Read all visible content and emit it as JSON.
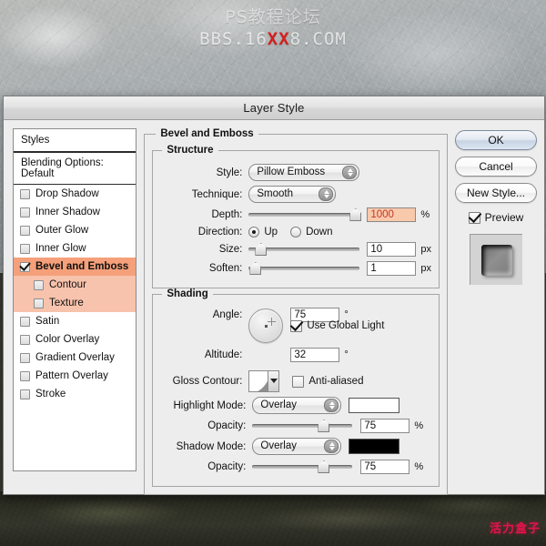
{
  "watermark": {
    "top_line1": "PS教程论坛",
    "top_line2_pre": "BBS.16",
    "top_line2_red": "XX",
    "top_line2_post": "8.COM",
    "bottom": "活力盒子"
  },
  "dialog": {
    "title": "Layer Style"
  },
  "styles_panel": {
    "header": "Styles",
    "blending_options": "Blending Options: Default",
    "effects": [
      {
        "label": "Drop Shadow",
        "checked": false,
        "sub": false,
        "selected": false
      },
      {
        "label": "Inner Shadow",
        "checked": false,
        "sub": false,
        "selected": false
      },
      {
        "label": "Outer Glow",
        "checked": false,
        "sub": false,
        "selected": false
      },
      {
        "label": "Inner Glow",
        "checked": false,
        "sub": false,
        "selected": false
      },
      {
        "label": "Bevel and Emboss",
        "checked": true,
        "sub": false,
        "selected": true
      },
      {
        "label": "Contour",
        "checked": false,
        "sub": true,
        "selected": false
      },
      {
        "label": "Texture",
        "checked": false,
        "sub": true,
        "selected": false
      },
      {
        "label": "Satin",
        "checked": false,
        "sub": false,
        "selected": false
      },
      {
        "label": "Color Overlay",
        "checked": false,
        "sub": false,
        "selected": false
      },
      {
        "label": "Gradient Overlay",
        "checked": false,
        "sub": false,
        "selected": false
      },
      {
        "label": "Pattern Overlay",
        "checked": false,
        "sub": false,
        "selected": false
      },
      {
        "label": "Stroke",
        "checked": false,
        "sub": false,
        "selected": false
      }
    ]
  },
  "main": {
    "group_title": "Bevel and Emboss",
    "structure": {
      "legend": "Structure",
      "style_label": "Style:",
      "style_value": "Pillow Emboss",
      "technique_label": "Technique:",
      "technique_value": "Smooth",
      "depth_label": "Depth:",
      "depth_value": "1000",
      "depth_unit": "%",
      "depth_pct": 100,
      "direction_label": "Direction:",
      "direction_up": "Up",
      "direction_down": "Down",
      "direction_selected": "Up",
      "size_label": "Size:",
      "size_value": "10",
      "size_unit": "px",
      "size_pct": 6,
      "soften_label": "Soften:",
      "soften_value": "1",
      "soften_unit": "px",
      "soften_pct": 1
    },
    "shading": {
      "legend": "Shading",
      "angle_label": "Angle:",
      "angle_value": "75",
      "angle_unit": "°",
      "use_global_light": "Use Global Light",
      "use_global_light_checked": true,
      "altitude_label": "Altitude:",
      "altitude_value": "32",
      "altitude_unit": "°",
      "gloss_contour_label": "Gloss Contour:",
      "anti_aliased": "Anti-aliased",
      "anti_aliased_checked": false,
      "highlight_mode_label": "Highlight Mode:",
      "highlight_mode_value": "Overlay",
      "highlight_color": "#ffffff",
      "highlight_opacity_label": "Opacity:",
      "highlight_opacity_value": "75",
      "highlight_opacity_unit": "%",
      "highlight_opacity_pct": 73,
      "shadow_mode_label": "Shadow Mode:",
      "shadow_mode_value": "Overlay",
      "shadow_color": "#000000",
      "shadow_opacity_label": "Opacity:",
      "shadow_opacity_value": "75",
      "shadow_opacity_unit": "%",
      "shadow_opacity_pct": 73
    }
  },
  "buttons": {
    "ok": "OK",
    "cancel": "Cancel",
    "new_style": "New Style...",
    "preview": "Preview",
    "preview_checked": true
  },
  "colors": {
    "selection_highlight": "#f5a07a",
    "selection_sub": "#f7c3ac",
    "hot_field_bg": "#f9c9ab",
    "hot_field_text": "#c0392b",
    "dialog_bg": "#ededed"
  }
}
